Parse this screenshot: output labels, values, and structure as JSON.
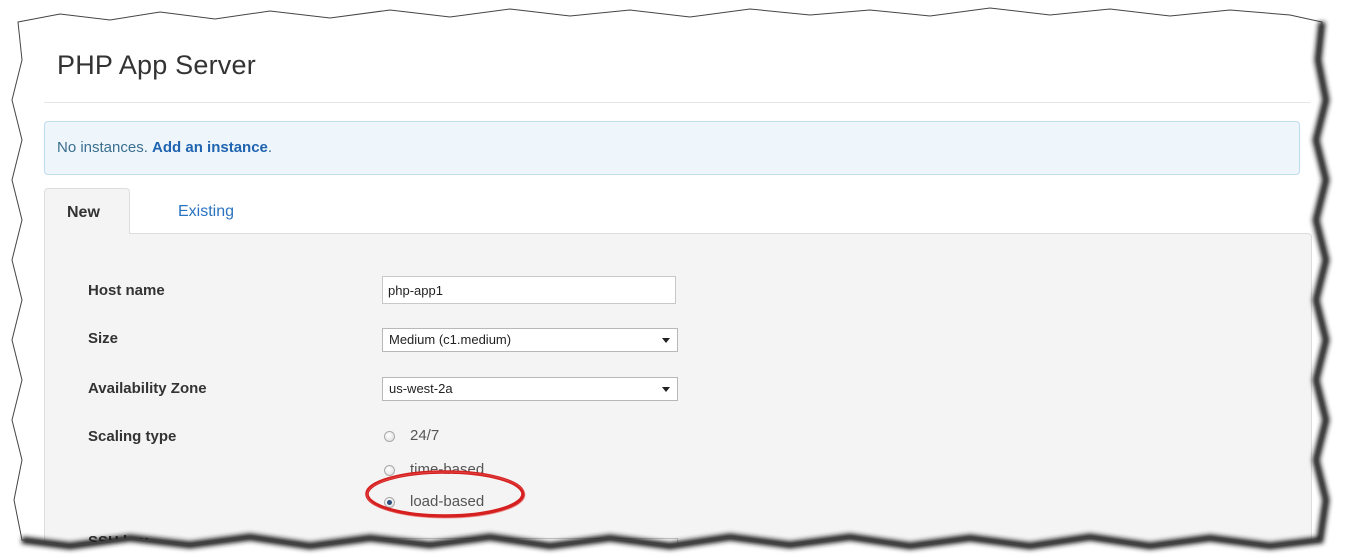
{
  "page": {
    "title": "PHP App Server"
  },
  "alert": {
    "text": "No instances. ",
    "link_label": "Add an instance",
    "suffix": "."
  },
  "tabs": [
    {
      "label": "New",
      "active": true
    },
    {
      "label": "Existing",
      "active": false
    }
  ],
  "form": {
    "host_name": {
      "label": "Host name",
      "value": "php-app1"
    },
    "size": {
      "label": "Size",
      "selected": "Medium (c1.medium)"
    },
    "availability_zone": {
      "label": "Availability Zone",
      "selected": "us-west-2a"
    },
    "scaling_type": {
      "label": "Scaling type",
      "options": [
        {
          "label": "24/7",
          "checked": false
        },
        {
          "label": "time-based",
          "checked": false
        },
        {
          "label": "load-based",
          "checked": true
        }
      ]
    },
    "ssh_key": {
      "label": "SSH key"
    }
  },
  "colors": {
    "alert_bg": "#eef5fb",
    "link": "#1f64b0",
    "highlight_ring": "#d61f1f"
  }
}
